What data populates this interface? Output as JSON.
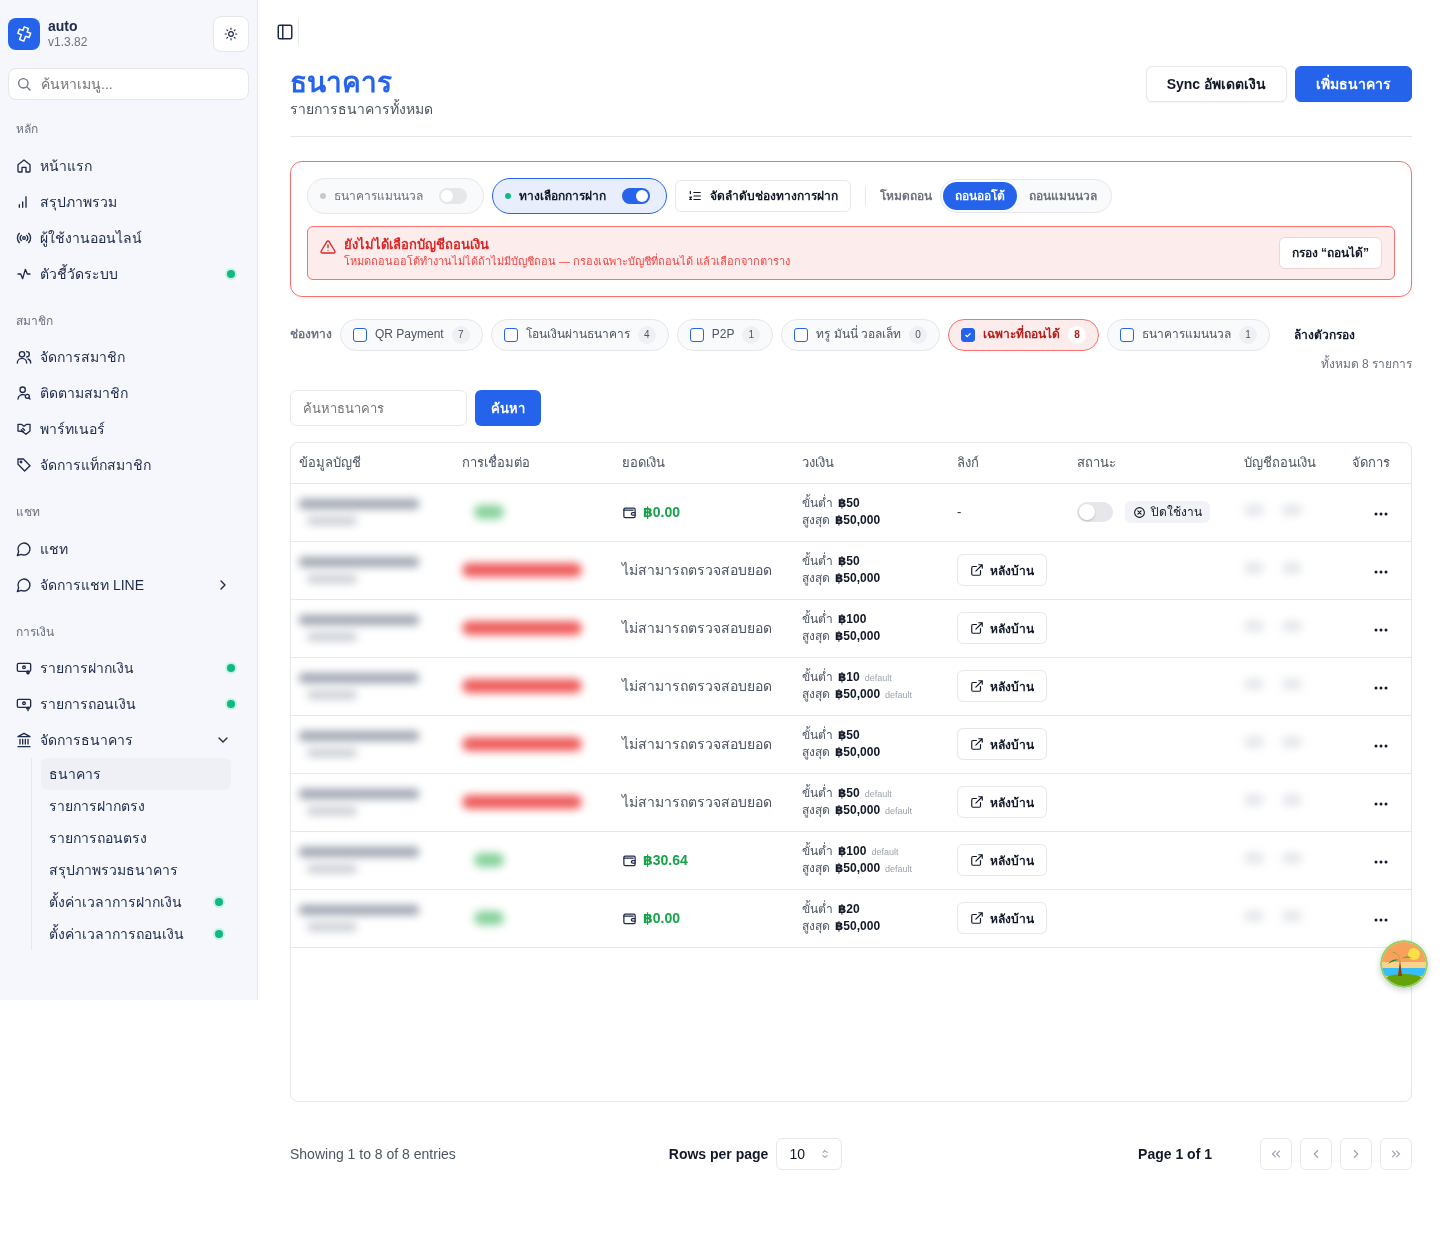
{
  "sidebar": {
    "app_name": "auto",
    "version": "v1.3.82",
    "search": {
      "placeholder": "ค้นหาเมนู..."
    },
    "sections": [
      {
        "title": "หลัก",
        "items": [
          {
            "label": "หน้าแรก",
            "kind": "link",
            "indicator": false
          },
          {
            "label": "สรุปภาพรวม",
            "kind": "link",
            "indicator": false
          },
          {
            "label": "ผู้ใช้งานออนไลน์",
            "kind": "link",
            "indicator": false
          },
          {
            "label": "ตัวชี้วัดระบบ",
            "kind": "link",
            "indicator": true
          }
        ]
      },
      {
        "title": "สมาชิก",
        "items": [
          {
            "label": "จัดการสมาชิก",
            "kind": "link",
            "indicator": false
          },
          {
            "label": "ติดตามสมาชิก",
            "kind": "link",
            "indicator": false
          },
          {
            "label": "พาร์ทเนอร์",
            "kind": "link",
            "indicator": false
          },
          {
            "label": "จัดการแท็กสมาชิก",
            "kind": "link",
            "indicator": false
          }
        ]
      },
      {
        "title": "แชท",
        "items": [
          {
            "label": "แชท",
            "kind": "link",
            "indicator": false
          },
          {
            "label": "จัดการแชท LINE",
            "kind": "group",
            "expanded": false,
            "indicator": false
          }
        ]
      },
      {
        "title": "การเงิน",
        "items": [
          {
            "label": "รายการฝากเงิน",
            "kind": "link",
            "indicator": true
          },
          {
            "label": "รายการถอนเงิน",
            "kind": "link",
            "indicator": true
          },
          {
            "label": "จัดการธนาคาร",
            "kind": "group",
            "expanded": true,
            "indicator": false,
            "children": [
              {
                "label": "ธนาคาร",
                "selected": true,
                "indicator": false
              },
              {
                "label": "รายการฝากตรง",
                "selected": false,
                "indicator": false
              },
              {
                "label": "รายการถอนตรง",
                "selected": false,
                "indicator": false
              },
              {
                "label": "สรุปภาพรวมธนาคาร",
                "selected": false,
                "indicator": false
              },
              {
                "label": "ตั้งค่าเวลาการฝากเงิน",
                "selected": false,
                "indicator": true
              },
              {
                "label": "ตั้งค่าเวลาการถอนเงิน",
                "selected": false,
                "indicator": true
              }
            ]
          }
        ]
      }
    ]
  },
  "header": {
    "title": "ธนาคาร",
    "subtitle": "รายการธนาคารทั้งหมด",
    "buttons": [
      {
        "label": "Sync อัพเดตเงิน",
        "kind": "secondary"
      },
      {
        "label": "เพิ่มธนาคาร",
        "kind": "primary"
      }
    ]
  },
  "settings": {
    "toggles": [
      {
        "label": "ธนาคารแมนนวล",
        "on": false
      },
      {
        "label": "ทางเลือกการฝาก",
        "on": true
      }
    ],
    "order_button": "จัดลำดับช่องทางการฝาก",
    "withdraw_mode": {
      "label": "โหมดถอน",
      "options": [
        {
          "label": "ถอนออโต้",
          "selected": true
        },
        {
          "label": "ถอนแมนนวล",
          "selected": false
        }
      ]
    },
    "alert": {
      "title": "ยังไม่ได้เลือกบัญชีถอนเงิน",
      "message": "โหมดถอนออโต้ทำงานไม่ได้ถ้าไม่มีบัญชีถอน — กรองเฉพาะบัญชีที่ถอนได้ แล้วเลือกจากตาราง",
      "button": "กรอง “ถอนได้”"
    }
  },
  "channels": {
    "label": "ช่องทาง",
    "chips": [
      {
        "label": "QR Payment",
        "count": "7",
        "checked": false
      },
      {
        "label": "โอนเงินผ่านธนาคาร",
        "count": "4",
        "checked": false
      },
      {
        "label": "P2P",
        "count": "1",
        "checked": false
      },
      {
        "label": "ทรู มันนี่ วอลเล็ท",
        "count": "0",
        "checked": false
      },
      {
        "label": "เฉพาะที่ถอนได้",
        "count": "8",
        "checked": true
      },
      {
        "label": "ธนาคารแมนนวล",
        "count": "1",
        "checked": false
      }
    ],
    "clear": "ล้างตัวกรอง",
    "total": "ทั้งหมด 8 รายการ"
  },
  "search": {
    "placeholder": "ค้นหาธนาคาร",
    "button": "ค้นหา"
  },
  "table": {
    "columns": [
      "ข้อมูลบัญชี",
      "การเชื่อมต่อ",
      "ยอดเงิน",
      "วงเงิน",
      "ลิงก์",
      "สถานะ",
      "บัญชีถอนเงิน",
      "จัดการ"
    ],
    "rows": [
      {
        "connected": true,
        "balance": {
          "kind": "amount",
          "text": "฿0.00"
        },
        "min": {
          "label": "ขั้นต่ำ",
          "value": "฿50"
        },
        "max": {
          "label": "สูงสุด",
          "value": "฿50,000"
        },
        "link": {
          "kind": "dash",
          "text": "-"
        },
        "status": {
          "on": false,
          "label": "ปิดใช้งาน"
        }
      },
      {
        "connected": false,
        "balance": {
          "kind": "error",
          "text": "ไม่สามารถตรวจสอบยอด"
        },
        "min": {
          "label": "ขั้นต่ำ",
          "value": "฿50"
        },
        "max": {
          "label": "สูงสุด",
          "value": "฿50,000"
        },
        "link": {
          "kind": "button",
          "text": "หลังบ้าน"
        }
      },
      {
        "connected": false,
        "balance": {
          "kind": "error",
          "text": "ไม่สามารถตรวจสอบยอด"
        },
        "min": {
          "label": "ขั้นต่ำ",
          "value": "฿100"
        },
        "max": {
          "label": "สูงสุด",
          "value": "฿50,000"
        },
        "link": {
          "kind": "button",
          "text": "หลังบ้าน"
        }
      },
      {
        "connected": false,
        "balance": {
          "kind": "error",
          "text": "ไม่สามารถตรวจสอบยอด"
        },
        "min": {
          "label": "ขั้นต่ำ",
          "value": "฿10",
          "note": "default"
        },
        "max": {
          "label": "สูงสุด",
          "value": "฿50,000",
          "note": "default"
        },
        "link": {
          "kind": "button",
          "text": "หลังบ้าน"
        }
      },
      {
        "connected": false,
        "balance": {
          "kind": "error",
          "text": "ไม่สามารถตรวจสอบยอด"
        },
        "min": {
          "label": "ขั้นต่ำ",
          "value": "฿50"
        },
        "max": {
          "label": "สูงสุด",
          "value": "฿50,000"
        },
        "link": {
          "kind": "button",
          "text": "หลังบ้าน"
        }
      },
      {
        "connected": false,
        "balance": {
          "kind": "error",
          "text": "ไม่สามารถตรวจสอบยอด"
        },
        "min": {
          "label": "ขั้นต่ำ",
          "value": "฿50",
          "note": "default"
        },
        "max": {
          "label": "สูงสุด",
          "value": "฿50,000",
          "note": "default"
        },
        "link": {
          "kind": "button",
          "text": "หลังบ้าน"
        }
      },
      {
        "connected": true,
        "balance": {
          "kind": "amount",
          "text": "฿30.64"
        },
        "min": {
          "label": "ขั้นต่ำ",
          "value": "฿100",
          "note": "default"
        },
        "max": {
          "label": "สูงสุด",
          "value": "฿50,000",
          "note": "default"
        },
        "link": {
          "kind": "button",
          "text": "หลังบ้าน"
        }
      },
      {
        "connected": true,
        "balance": {
          "kind": "amount",
          "text": "฿0.00"
        },
        "min": {
          "label": "ขั้นต่ำ",
          "value": "฿20"
        },
        "max": {
          "label": "สูงสุด",
          "value": "฿50,000"
        },
        "link": {
          "kind": "button",
          "text": "หลังบ้าน"
        }
      }
    ]
  },
  "footer": {
    "showing": "Showing 1 to 8 of 8 entries",
    "rows_label": "Rows per page",
    "rows_value": "10",
    "page": "Page 1 of 1"
  }
}
